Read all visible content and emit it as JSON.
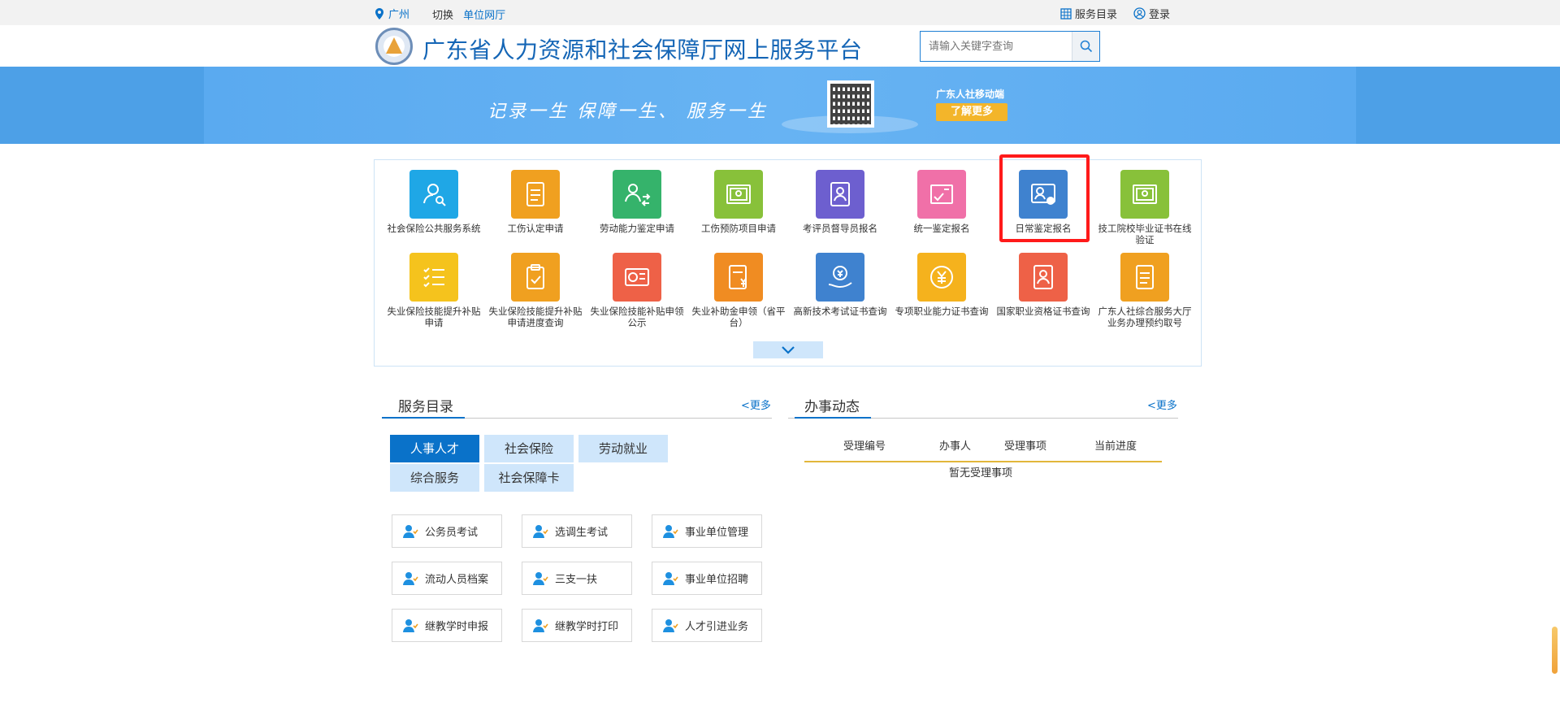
{
  "topbar": {
    "location": "广州",
    "switch_label": "切换",
    "unit_hall": "单位网厅",
    "service_directory": "服务目录",
    "login": "登录"
  },
  "header": {
    "title": "广东省人力资源和社会保障厅网上服务平台",
    "search_placeholder": "请输入关键字查询"
  },
  "banner": {
    "slogan": "记录一生  保障一生、 服务一生",
    "mobile_label": "广东人社移动端",
    "more_label": "了解更多"
  },
  "apps": [
    {
      "label": "社会保险公共服务系统",
      "color": "#1fa7e6",
      "icon": "user-search-icon"
    },
    {
      "label": "工伤认定申请",
      "color": "#f0a020",
      "icon": "document-icon"
    },
    {
      "label": "劳动能力鉴定申请",
      "color": "#35b36b",
      "icon": "users-exchange-icon"
    },
    {
      "label": "工伤预防项目申请",
      "color": "#88c13a",
      "icon": "certificate-icon"
    },
    {
      "label": "考评员督导员报名",
      "color": "#6d5fcf",
      "icon": "id-card-icon"
    },
    {
      "label": "统一鉴定报名",
      "color": "#f070a8",
      "icon": "exam-icon"
    },
    {
      "label": "日常鉴定报名",
      "color": "#3f82cf",
      "icon": "badge-icon"
    },
    {
      "label": "技工院校毕业证书在线验证",
      "color": "#88c13a",
      "icon": "certificate-icon"
    },
    {
      "label": "失业保险技能提升补贴申请",
      "color": "#f5c31d",
      "icon": "checklist-icon"
    },
    {
      "label": "失业保险技能提升补贴申请进度查询",
      "color": "#f0a020",
      "icon": "clipboard-icon"
    },
    {
      "label": "失业保险技能补贴申领公示",
      "color": "#ee6147",
      "icon": "card-icon"
    },
    {
      "label": "失业补助金申领（省平台）",
      "color": "#f08c22",
      "icon": "money-document-icon"
    },
    {
      "label": "高新技术考试证书查询",
      "color": "#3f82cf",
      "icon": "coin-hand-icon"
    },
    {
      "label": "专项职业能力证书查询",
      "color": "#f5b21d",
      "icon": "yuan-coin-icon"
    },
    {
      "label": "国家职业资格证书查询",
      "color": "#ee6147",
      "icon": "profile-doc-icon"
    },
    {
      "label": "广东人社综合服务大厅业务办理预约取号",
      "color": "#f0a020",
      "icon": "note-icon"
    }
  ],
  "catalog": {
    "title": "服务目录",
    "more": "<更多",
    "tabs": [
      "人事人才",
      "社会保险",
      "劳动就业",
      "综合服务",
      "社会保障卡"
    ],
    "services": [
      "公务员考试",
      "选调生考试",
      "事业单位管理",
      "流动人员档案",
      "三支一扶",
      "事业单位招聘",
      "继教学时申报",
      "继教学时打印",
      "人才引进业务"
    ]
  },
  "progress": {
    "title": "办事动态",
    "more": "<更多",
    "columns": [
      "受理编号",
      "办事人",
      "受理事项",
      "当前进度"
    ],
    "empty": "暂无受理事项"
  },
  "colors": {
    "brand_blue": "#0a72c9",
    "banner_blue": "#4da0e7",
    "highlight_red": "#ff1a1a"
  }
}
